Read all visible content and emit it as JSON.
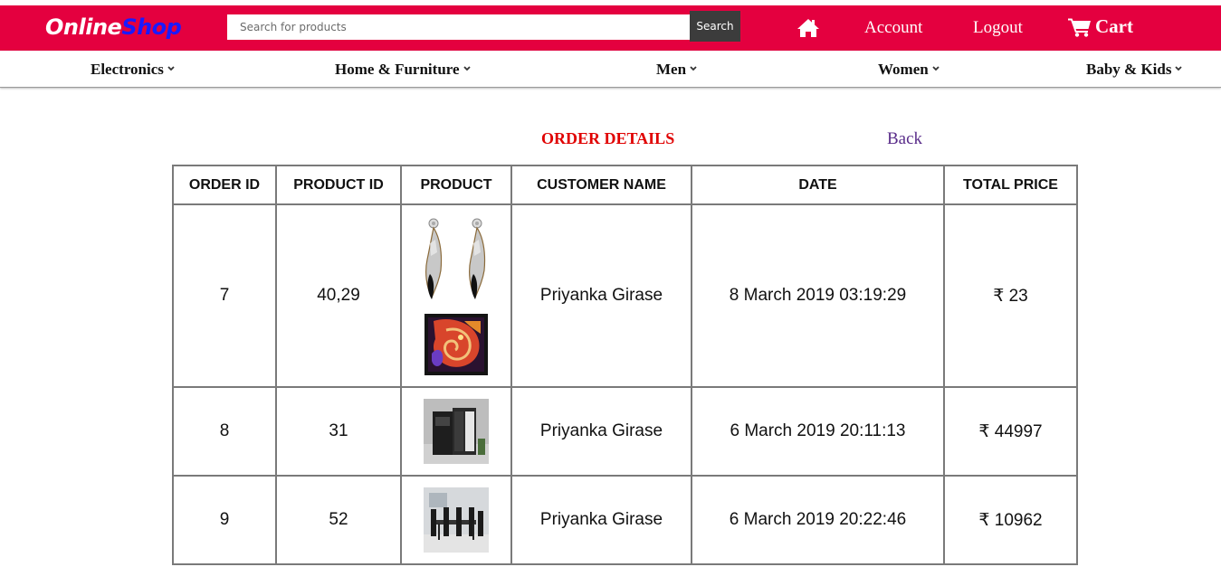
{
  "header": {
    "logo_part1": "Online",
    "logo_part2": "Shop",
    "search_placeholder": "Search for products",
    "search_button": "Search",
    "account_label": "Account",
    "logout_label": "Logout",
    "cart_label": "Cart",
    "colors": {
      "brand": "#e4003f",
      "logo_accent": "#1a1aff",
      "search_button_bg": "#3c3c3c"
    }
  },
  "categories": [
    "Electronics",
    "Home & Furniture",
    "Men",
    "Women",
    "Baby & Kids"
  ],
  "page": {
    "title": "ORDER DETAILS",
    "back_label": "Back",
    "title_color": "#e00000",
    "back_color": "#5a2d8a"
  },
  "table": {
    "headers": [
      "ORDER ID",
      "PRODUCT ID",
      "PRODUCT",
      "CUSTOMER NAME",
      "DATE",
      "TOTAL PRICE"
    ],
    "rows": [
      {
        "order_id": "7",
        "product_id": "40,29",
        "products": [
          "earrings-image",
          "ganesha-painting-image"
        ],
        "customer": "Priyanka Girase",
        "date": "8 March 2019 03:19:29",
        "total": "₹ 23"
      },
      {
        "order_id": "8",
        "product_id": "31",
        "products": [
          "wardrobe-image"
        ],
        "customer": "Priyanka Girase",
        "date": "6 March 2019 20:11:13",
        "total": "₹ 44997"
      },
      {
        "order_id": "9",
        "product_id": "52",
        "products": [
          "dining-set-image"
        ],
        "customer": "Priyanka Girase",
        "date": "6 March 2019 20:22:46",
        "total": "₹ 10962"
      }
    ]
  },
  "icons": [
    "home-icon",
    "cart-icon",
    "chevron-down-icon"
  ]
}
